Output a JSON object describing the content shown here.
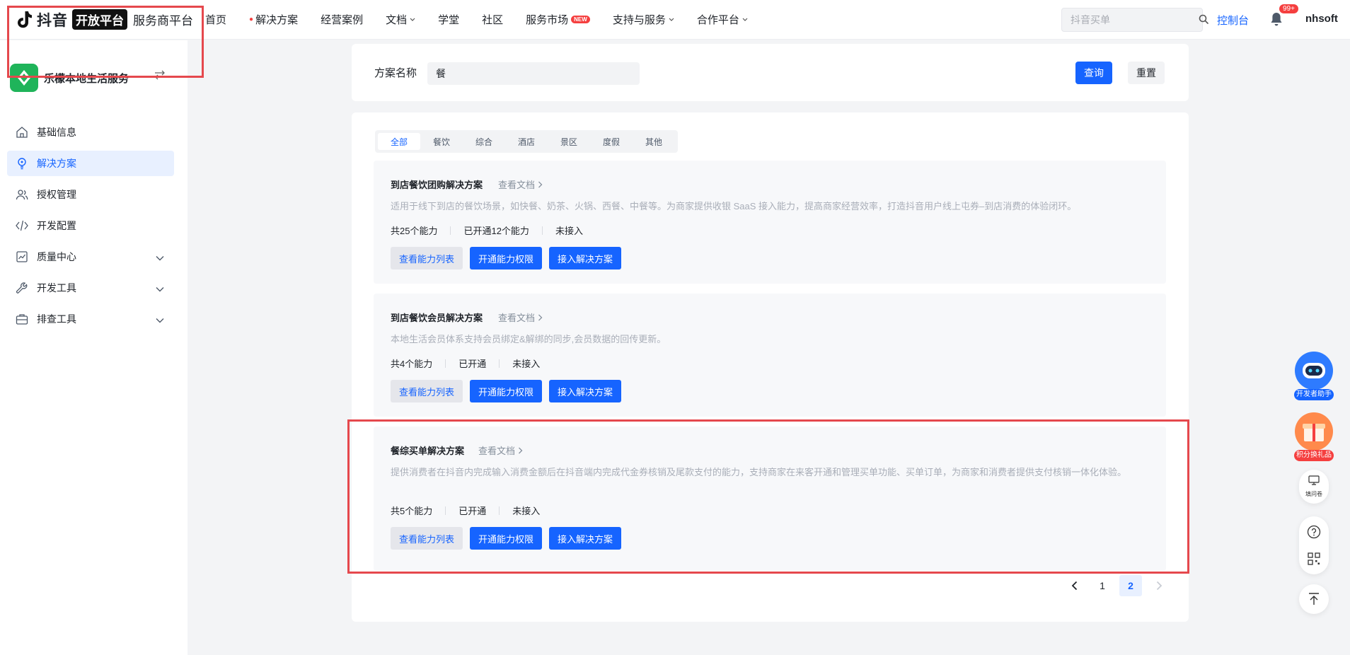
{
  "header": {
    "brand_name": "抖音",
    "brand_tag": "开放平台",
    "brand_sub": "服务商平台",
    "nav": [
      {
        "label": "首页"
      },
      {
        "label": "解决方案",
        "hot": true
      },
      {
        "label": "经营案例"
      },
      {
        "label": "文档",
        "dropdown": true
      },
      {
        "label": "学堂"
      },
      {
        "label": "社区"
      },
      {
        "label": "服务市场",
        "badge": "NEW"
      },
      {
        "label": "支持与服务",
        "dropdown": true
      },
      {
        "label": "合作平台",
        "dropdown": true
      }
    ],
    "search_placeholder": "抖音买单",
    "console_label": "控制台",
    "notification_count": "99+",
    "username": "nhsoft"
  },
  "sidebar": {
    "app_name": "乐檬本地生活服务",
    "items": [
      {
        "label": "基础信息",
        "icon": "home-icon"
      },
      {
        "label": "解决方案",
        "icon": "bulb-icon",
        "active": true
      },
      {
        "label": "授权管理",
        "icon": "users-icon"
      },
      {
        "label": "开发配置",
        "icon": "code-icon"
      },
      {
        "label": "质量中心",
        "icon": "chart-icon",
        "expandable": true
      },
      {
        "label": "开发工具",
        "icon": "wrench-icon",
        "expandable": true
      },
      {
        "label": "排查工具",
        "icon": "toolbox-icon",
        "expandable": true
      }
    ]
  },
  "filter": {
    "label": "方案名称",
    "value": "餐",
    "query_label": "查询",
    "reset_label": "重置"
  },
  "tabs": [
    {
      "label": "全部",
      "active": true
    },
    {
      "label": "餐饮"
    },
    {
      "label": "综合"
    },
    {
      "label": "酒店"
    },
    {
      "label": "景区"
    },
    {
      "label": "度假"
    },
    {
      "label": "其他"
    }
  ],
  "solutions": [
    {
      "title": "到店餐饮团购解决方案",
      "doc_link": "查看文档",
      "desc": "适用于线下到店的餐饮场景，如快餐、奶茶、火锅、西餐、中餐等。为商家提供收银 SaaS 接入能力，提高商家经营效率，打造抖音用户线上屯券–到店消费的体验闭环。",
      "stats": [
        "共25个能力",
        "已开通12个能力",
        "未接入"
      ],
      "btn_list": "查看能力列表",
      "btn_open": "开通能力权限",
      "btn_connect": "接入解决方案"
    },
    {
      "title": "到店餐饮会员解决方案",
      "doc_link": "查看文档",
      "desc": "本地生活会员体系支持会员绑定&解绑的同步,会员数据的回传更新。",
      "stats": [
        "共4个能力",
        "已开通",
        "未接入"
      ],
      "btn_list": "查看能力列表",
      "btn_open": "开通能力权限",
      "btn_connect": "接入解决方案"
    },
    {
      "title": "餐综买单解决方案",
      "doc_link": "查看文档",
      "desc": "提供消费者在抖音内完成输入消费金额后在抖音端内完成代金券核销及尾款支付的能力，支持商家在来客开通和管理买单功能、买单订单，为商家和消费者提供支付核销一体化体验。",
      "stats": [
        "共5个能力",
        "已开通",
        "未接入"
      ],
      "btn_list": "查看能力列表",
      "btn_open": "开通能力权限",
      "btn_connect": "接入解决方案"
    }
  ],
  "pagination": {
    "pages": [
      "1",
      "2"
    ],
    "current": "2"
  },
  "floating": {
    "assistant_label": "开发者助手",
    "gift_label": "积分换礼品",
    "survey_label": "填问卷"
  },
  "colors": {
    "primary": "#1664ff",
    "highlight_border": "#e5484d",
    "app_icon": "#1fb45a"
  }
}
